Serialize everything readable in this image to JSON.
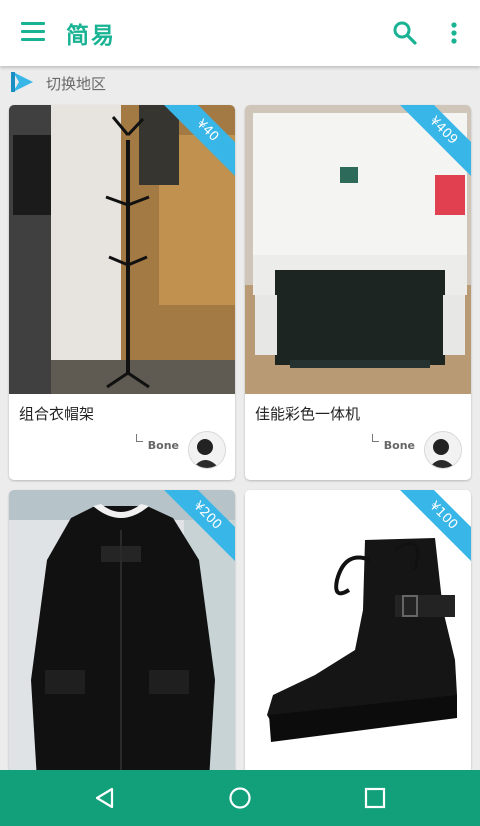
{
  "app": {
    "title": "简易"
  },
  "region": {
    "label": "切换地区"
  },
  "icons": {
    "menu": "menu-icon",
    "search": "search-icon",
    "more": "more-vert-icon",
    "region": "region-switch-icon",
    "back": "back-icon",
    "home": "home-icon",
    "recent": "recent-apps-icon"
  },
  "colors": {
    "brand": "#19b394",
    "ribbon": "#39b6e8",
    "navbar": "#11a07a"
  },
  "listings": [
    {
      "title": "组合衣帽架",
      "price": "¥40",
      "seller": "Bone",
      "photo": "coat-rack"
    },
    {
      "title": "佳能彩色一体机",
      "price": "¥409",
      "seller": "Bone",
      "photo": "printer"
    },
    {
      "title": "",
      "price": "¥200",
      "seller": "",
      "photo": "black-coat"
    },
    {
      "title": "",
      "price": "¥100",
      "seller": "",
      "photo": "leather-boot"
    }
  ]
}
